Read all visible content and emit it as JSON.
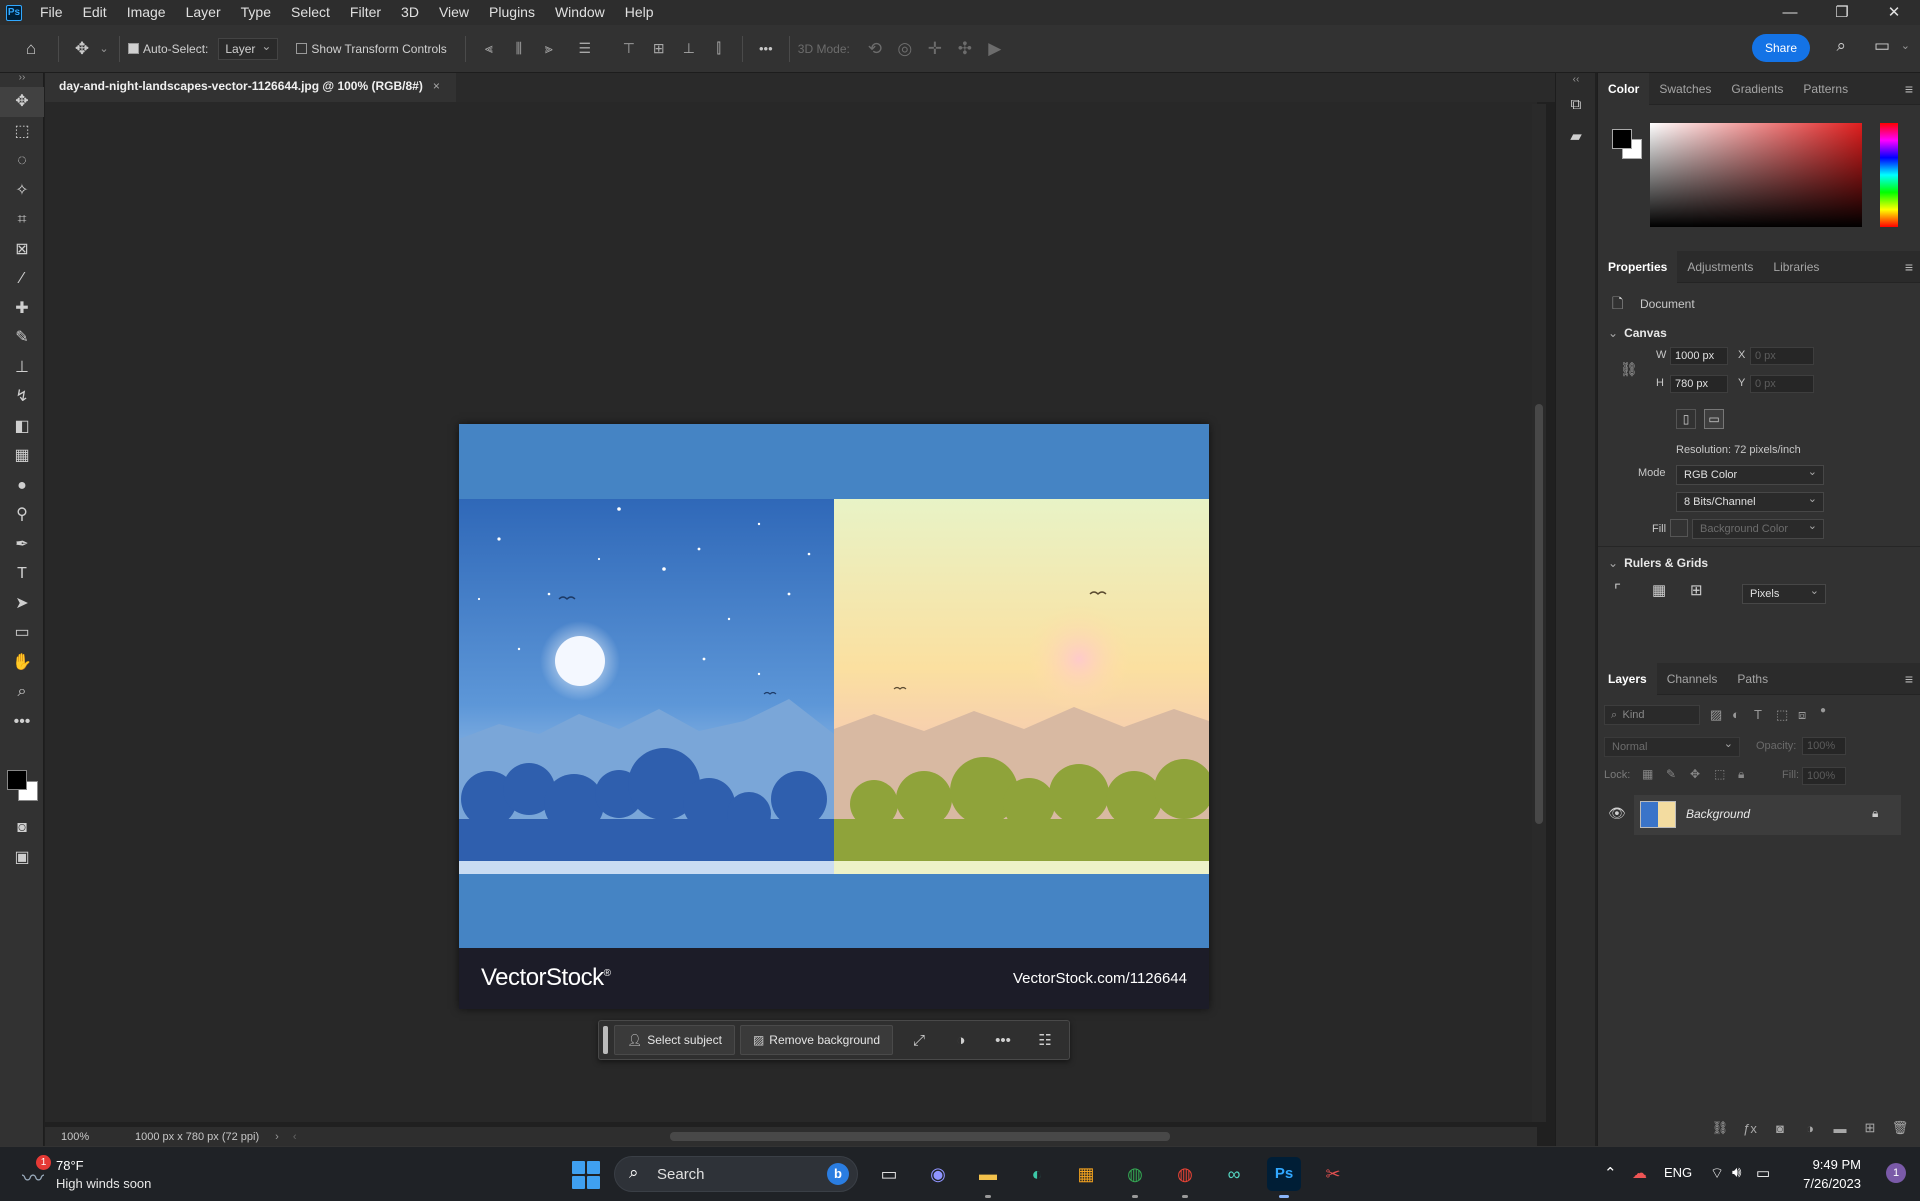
{
  "app": {
    "logo_text": "Ps"
  },
  "menubar": {
    "items": [
      "File",
      "Edit",
      "Image",
      "Layer",
      "Type",
      "Select",
      "Filter",
      "3D",
      "View",
      "Plugins",
      "Window",
      "Help"
    ],
    "window_controls": [
      "—",
      "❐",
      "✕"
    ]
  },
  "options_bar": {
    "auto_select_label": "Auto-Select:",
    "auto_select_checked": true,
    "auto_select_target": "Layer",
    "transform_controls_label": "Show Transform Controls",
    "transform_controls_checked": false,
    "more_label": "•••",
    "mode_3d_label": "3D Mode:",
    "share_label": "Share"
  },
  "document": {
    "tab_title": "day-and-night-landscapes-vector-1126644.jpg @ 100% (RGB/8#)",
    "tab_close": "×",
    "zoom": "100%",
    "doc_info": "1000 px x 780 px (72 ppi)",
    "artwork": {
      "brand": "VectorStock",
      "brand_mark": "®",
      "url": "VectorStock.com/1126644"
    }
  },
  "context_bar": {
    "select_subject": "Select subject",
    "remove_background": "Remove background",
    "more": "•••"
  },
  "color_panel": {
    "tabs": [
      "Color",
      "Swatches",
      "Gradients",
      "Patterns"
    ],
    "foreground": "#000000",
    "background": "#ffffff",
    "hue_color": "#e01e1e"
  },
  "properties_panel": {
    "tabs": [
      "Properties",
      "Adjustments",
      "Libraries"
    ],
    "doc_label": "Document",
    "canvas_section": "Canvas",
    "w_label": "W",
    "w_value": "1000 px",
    "h_label": "H",
    "h_value": "780 px",
    "x_label": "X",
    "x_placeholder": "0 px",
    "y_label": "Y",
    "y_placeholder": "0 px",
    "resolution": "Resolution: 72 pixels/inch",
    "mode_label": "Mode",
    "mode_value": "RGB Color",
    "bits_value": "8 Bits/Channel",
    "fill_label": "Fill",
    "fill_value": "Background Color",
    "rulers_section": "Rulers & Grids",
    "units_value": "Pixels"
  },
  "layers_panel": {
    "tabs": [
      "Layers",
      "Channels",
      "Paths"
    ],
    "kind_placeholder": "Kind",
    "blend_mode": "Normal",
    "opacity_label": "Opacity:",
    "opacity_value": "100%",
    "lock_label": "Lock:",
    "fill_label": "Fill:",
    "fill_value": "100%",
    "layers": [
      {
        "name": "Background",
        "visible": true,
        "locked": true
      }
    ]
  },
  "taskbar": {
    "weather_temp": "78°F",
    "weather_desc": "High winds soon",
    "weather_badge": "1",
    "search_label": "Search",
    "lang": "ENG",
    "time": "9:49 PM",
    "date": "7/26/2023",
    "notifications": "1"
  }
}
